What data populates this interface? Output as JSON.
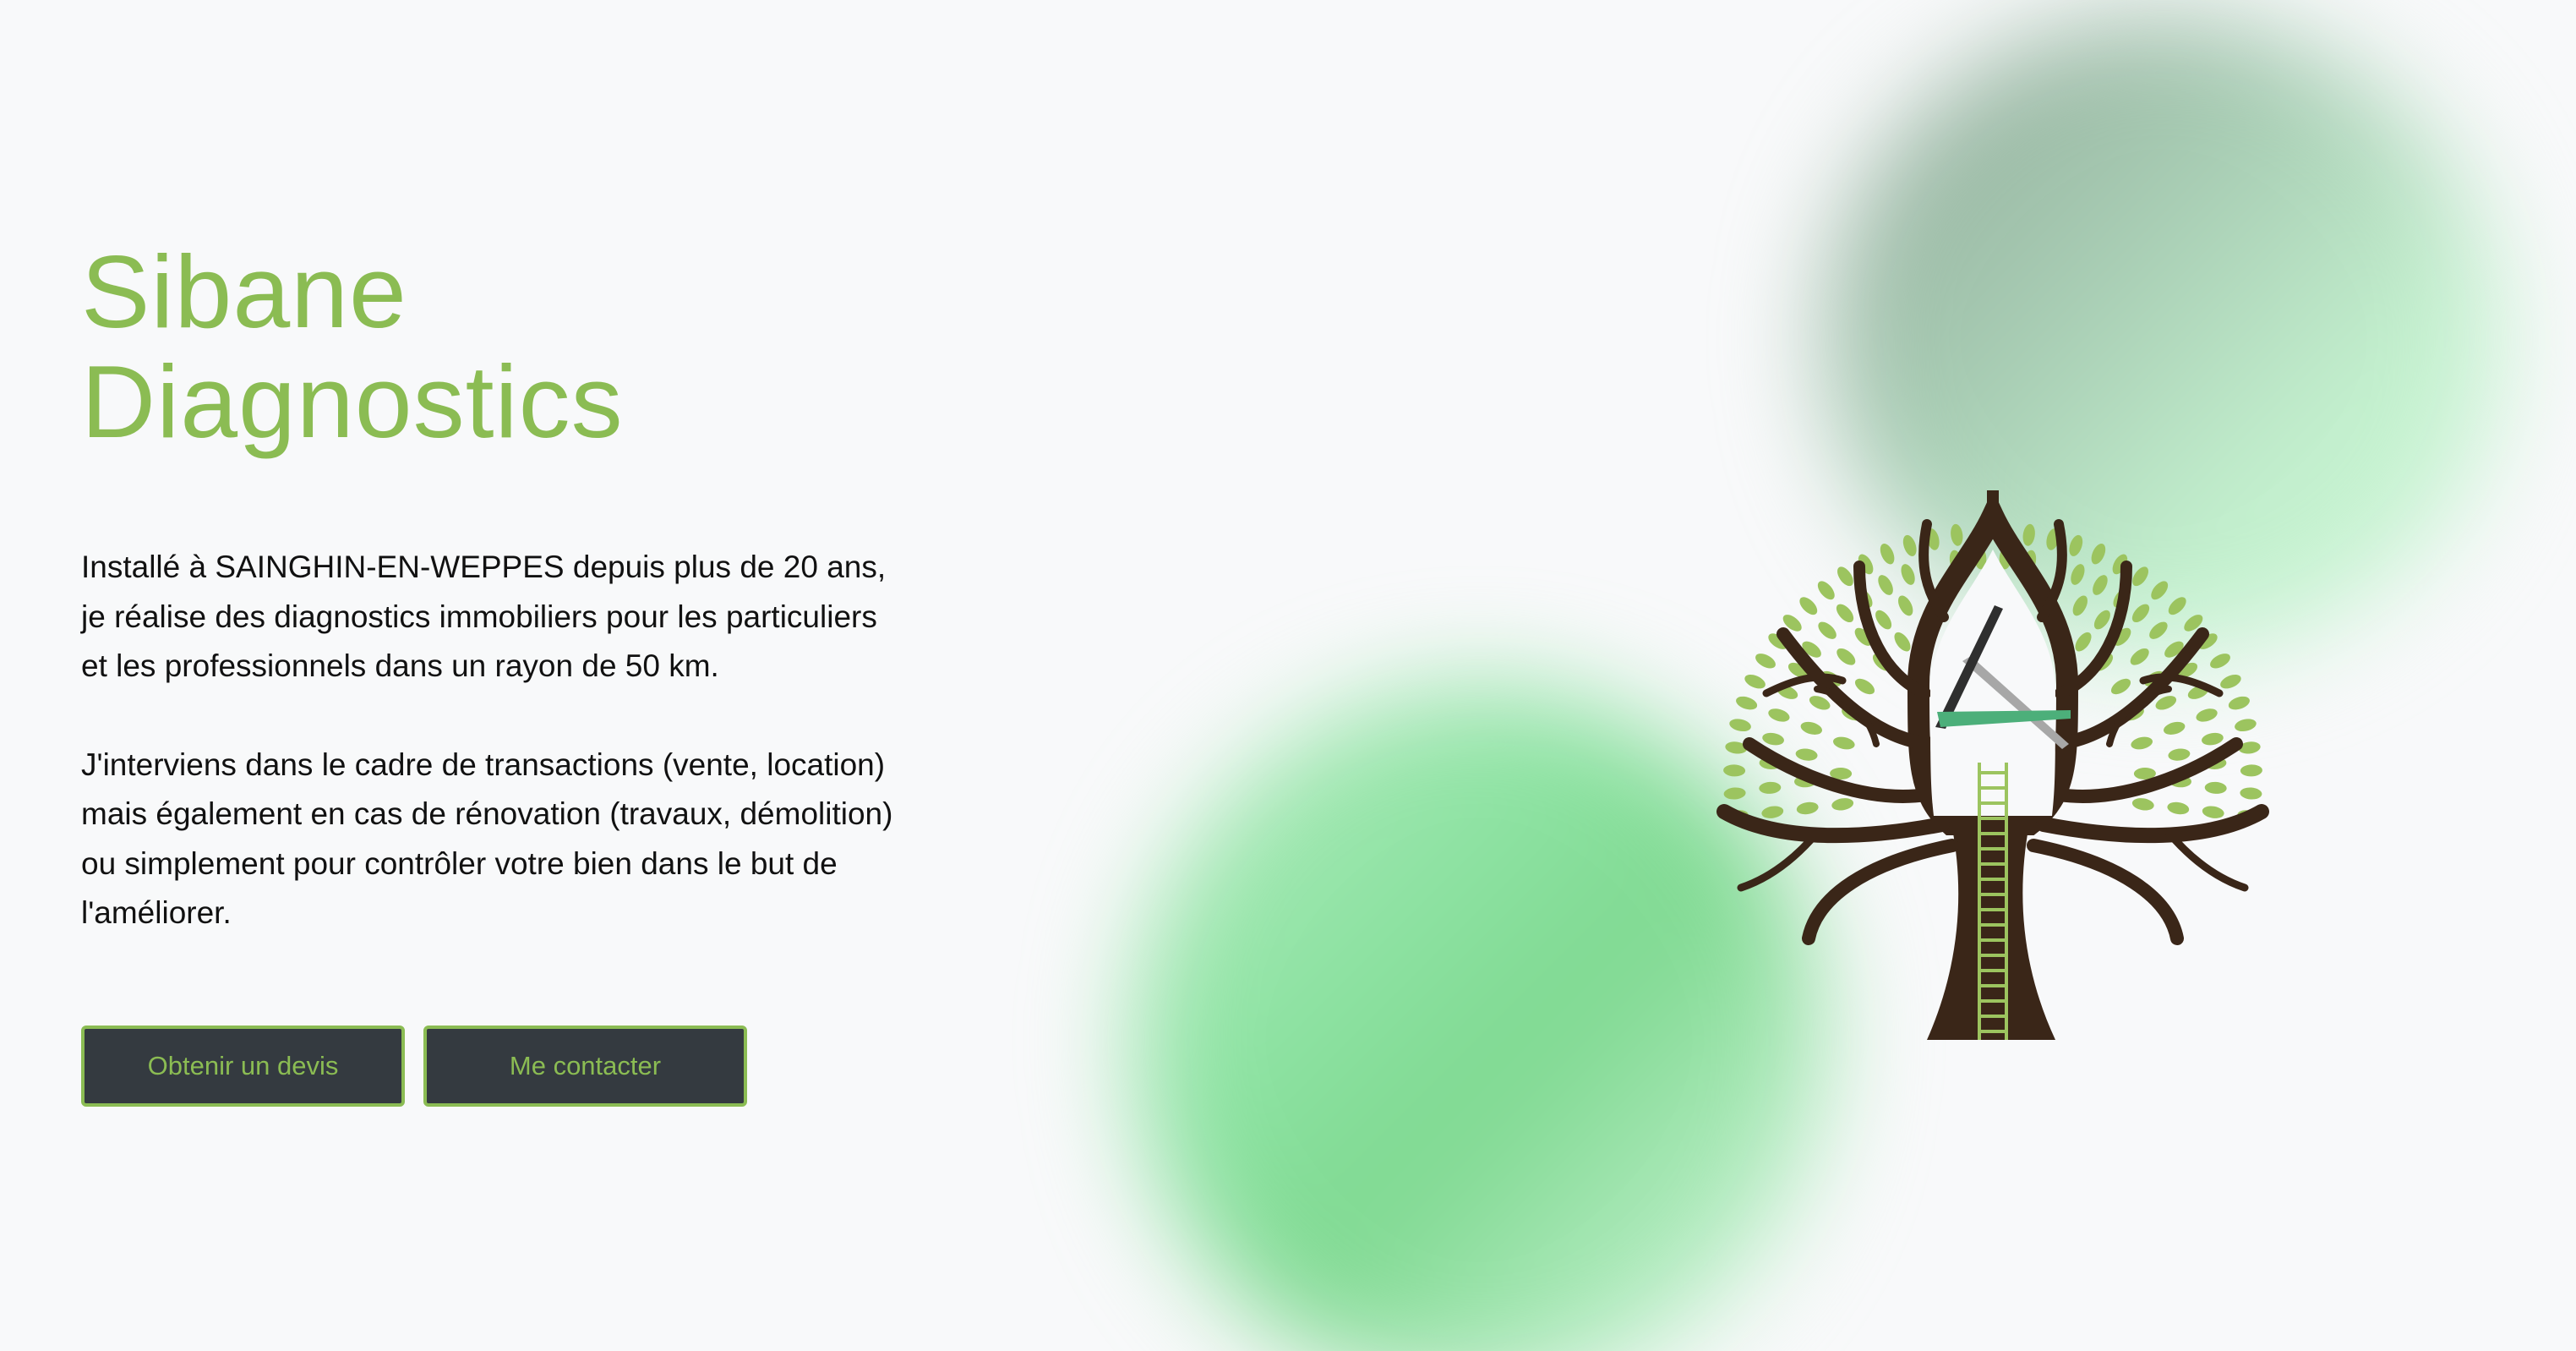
{
  "hero": {
    "title_line1": "Sibane",
    "title_line2": "Diagnostics",
    "paragraph1": "Installé à SAINGHIN-EN-WEPPES depuis plus de 20 ans, je réalise des diagnostics immobiliers pour les particuliers et les professionnels dans un rayon de 50 km.",
    "paragraph2": "J'interviens dans le cadre de transactions (vente, location) mais également en cas de rénovation (travaux, démolition) ou simplement pour contrôler votre bien dans le but de l'améliorer."
  },
  "buttons": {
    "quote_label": "Obtenir un devis",
    "contact_label": "Me contacter"
  },
  "logo": {
    "icon": "tree-house-clock-logo"
  },
  "colors": {
    "accent": "#8bbc53",
    "button_bg": "#343a40",
    "background": "#f8f9fa",
    "text": "#111111",
    "trunk": "#3a2618",
    "leaf": "#9cc45f",
    "clock_green": "#4caf7a"
  }
}
